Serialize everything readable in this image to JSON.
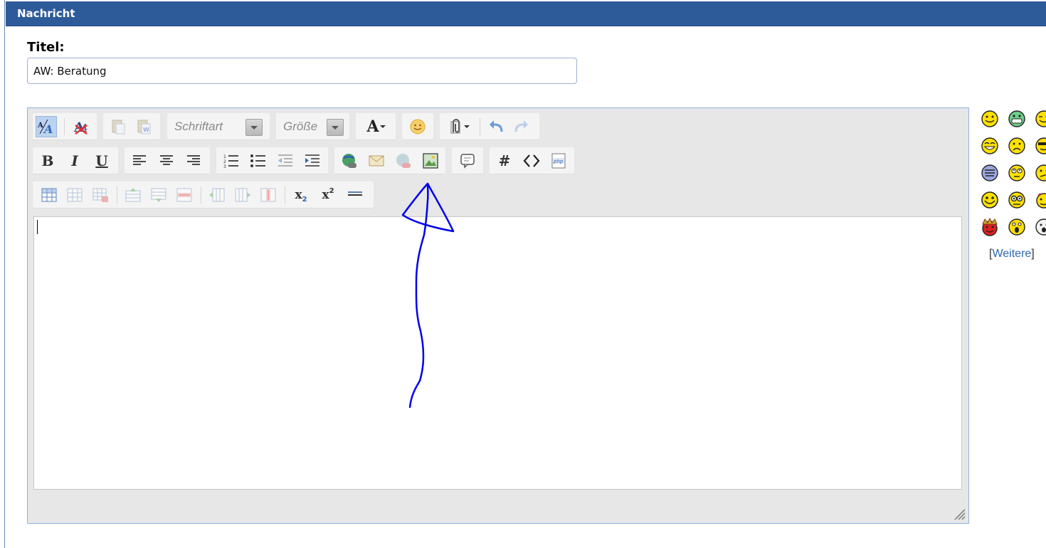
{
  "header": {
    "title": "Nachricht"
  },
  "form": {
    "title_label": "Titel:",
    "title_value": "AW: Beratung"
  },
  "toolbar": {
    "font_label": "Schriftart",
    "size_label": "Größe",
    "text_color_glyph": "A",
    "bold_glyph": "B",
    "italic_glyph": "I",
    "underline_glyph": "U",
    "hash_glyph": "#",
    "code_glyph": "<>",
    "php_glyph": "php",
    "sub_glyph": "x",
    "sub_index": "2",
    "sup_glyph": "x",
    "sup_index": "2",
    "icons": [
      "wysiwyg-toggle-icon",
      "remove-format-icon",
      "paste-icon",
      "paste-word-icon",
      "font-select",
      "size-select",
      "text-color-icon",
      "smiley-icon",
      "attach-icon",
      "undo-icon",
      "redo-icon",
      "bold-icon",
      "italic-icon",
      "underline-icon",
      "align-left-icon",
      "align-center-icon",
      "align-right-icon",
      "ordered-list-icon",
      "unordered-list-icon",
      "outdent-icon",
      "indent-icon",
      "link-icon",
      "email-icon",
      "unlink-icon",
      "image-icon",
      "quote-icon",
      "hash-icon",
      "code-icon",
      "php-icon",
      "table-icon",
      "table-props-icon",
      "delete-table-icon",
      "insert-row-above-icon",
      "insert-row-below-icon",
      "delete-row-icon",
      "insert-column-before-icon",
      "insert-column-after-icon",
      "delete-column-icon",
      "subscript-icon",
      "superscript-icon",
      "horizontal-rule-icon"
    ]
  },
  "editor": {
    "content": ""
  },
  "smilies": {
    "more_open": "[",
    "more_label": "Weitere",
    "more_close": "]",
    "icons": [
      "smile-icon",
      "grin-icon",
      "wink-icon",
      "cheesy-icon",
      "sad-icon",
      "cool-icon",
      "mustache-icon",
      "roll-eyes-icon",
      "confused-icon",
      "big-smile-icon",
      "nerd-icon",
      "devil-icon",
      "king-icon",
      "surprised-icon",
      "shocked-icon"
    ]
  },
  "colors": {
    "header_bg": "#2d5b9a",
    "annotation": "#0000ee",
    "link": "#2d66b6"
  }
}
